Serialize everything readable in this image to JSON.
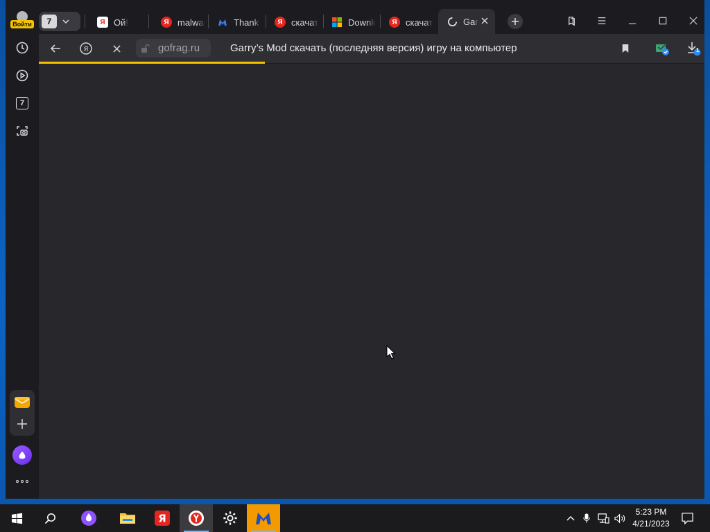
{
  "sidebar": {
    "login_label": "Войти",
    "tab_count_badge": "7",
    "items": [
      "history-icon",
      "video-icon",
      "tabs-counter-icon",
      "screenshot-icon"
    ]
  },
  "tabs": {
    "counter": "7",
    "list": [
      {
        "title": "Ой!",
        "favicon": "yandex-red"
      },
      {
        "title": "malwarebytes",
        "favicon": "yandex-red"
      },
      {
        "title": "Thank you",
        "favicon": "malwarebytes"
      },
      {
        "title": "скачать",
        "favicon": "yandex-red"
      },
      {
        "title": "Download",
        "favicon": "microsoft"
      },
      {
        "title": "скачать",
        "favicon": "yandex-red"
      },
      {
        "title": "Garry's Mod",
        "favicon": "loading",
        "active": true
      }
    ]
  },
  "toolbar": {
    "domain": "gofrag.ru",
    "page_title": "Garry’s Mod скачать (последняя версия) игру на компьютер",
    "downloads_badge": "1",
    "load_progress": 0.34
  },
  "taskbar": {
    "time": "5:23 PM",
    "date": "4/21/2023"
  },
  "colors": {
    "accent": "#f7c300",
    "content_bg": "#27272c",
    "toolbar_bg": "#2e2e33"
  }
}
